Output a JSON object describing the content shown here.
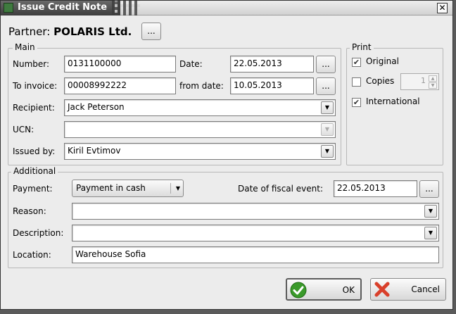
{
  "window": {
    "title": "Issue Credit Note"
  },
  "partner": {
    "label": "Partner:",
    "name": "POLARIS Ltd.",
    "browse_label": "..."
  },
  "main": {
    "legend": "Main",
    "number": {
      "label": "Number:",
      "value": "0131100000"
    },
    "date": {
      "label": "Date:",
      "value": "22.05.2013",
      "browse_label": "..."
    },
    "to_invoice": {
      "label": "To invoice:",
      "value": "00008992222"
    },
    "from_date": {
      "label": "from date:",
      "value": "10.05.2013",
      "browse_label": "..."
    },
    "recipient": {
      "label": "Recipient:",
      "value": "Jack Peterson"
    },
    "ucn": {
      "label": "UCN:",
      "value": ""
    },
    "issued_by": {
      "label": "Issued by:",
      "value": "Kiril Evtimov"
    }
  },
  "print": {
    "legend": "Print",
    "original": {
      "label": "Original",
      "checked": true
    },
    "copies": {
      "label": "Copies",
      "checked": false,
      "count": "1"
    },
    "international": {
      "label": "International",
      "checked": true
    }
  },
  "additional": {
    "legend": "Additional",
    "payment": {
      "label": "Payment:",
      "value": "Payment in cash"
    },
    "fiscal_date": {
      "label": "Date of fiscal event:",
      "value": "22.05.2013",
      "browse_label": "..."
    },
    "reason": {
      "label": "Reason:",
      "value": ""
    },
    "description": {
      "label": "Description:",
      "value": ""
    },
    "location": {
      "label": "Location:",
      "value": "Warehouse Sofia"
    }
  },
  "buttons": {
    "ok": "OK",
    "cancel": "Cancel"
  },
  "colors": {
    "ok_green": "#3a9a2a",
    "cancel_red": "#d9402b",
    "title_dark": "#3c3c3c"
  }
}
